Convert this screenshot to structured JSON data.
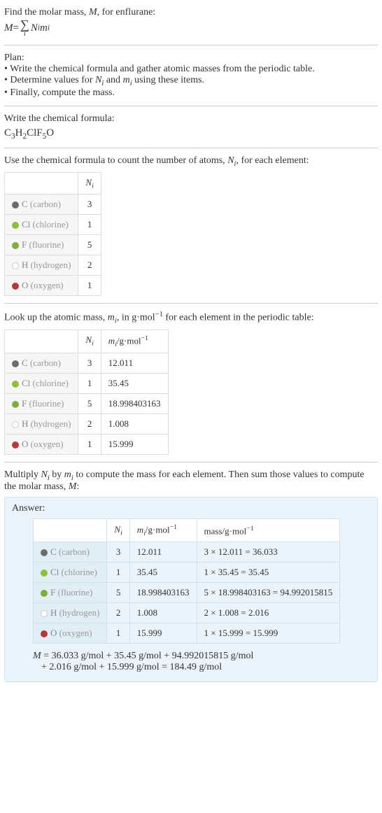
{
  "intro": {
    "line1_a": "Find the molar mass, ",
    "line1_b": "M",
    "line1_c": ", for enflurane:",
    "eq_lhs": "M",
    "eq_eq": " = ",
    "eq_N": "N",
    "eq_i1": "i",
    "eq_m": "m",
    "eq_i2": "i",
    "sigma_sub": "i"
  },
  "plan": {
    "heading": "Plan:",
    "b1_a": "• Write the chemical formula and gather atomic masses from the periodic table.",
    "b2_a": "• Determine values for ",
    "b2_N": "N",
    "b2_i1": "i",
    "b2_mid": " and ",
    "b2_m": "m",
    "b2_i2": "i",
    "b2_end": " using these items.",
    "b3": "• Finally, compute the mass."
  },
  "chem": {
    "heading": "Write the chemical formula:",
    "C": "C",
    "n3": "3",
    "H": "H",
    "n2": "2",
    "Cl": "Cl",
    "F": "F",
    "n5": "5",
    "O": "O"
  },
  "count": {
    "text_a": "Use the chemical formula to count the number of atoms, ",
    "text_N": "N",
    "text_i": "i",
    "text_b": ", for each element:",
    "col_N": "N",
    "col_i": "i"
  },
  "elements": [
    {
      "sw": "#6b6b6b",
      "sym": "C",
      "name": "(carbon)",
      "N": "3",
      "m": "12.011",
      "mass": "3 × 12.011 = 36.033"
    },
    {
      "sw": "#8fbf3f",
      "sym": "Cl",
      "name": "(chlorine)",
      "N": "1",
      "m": "35.45",
      "mass": "1 × 35.45 = 35.45"
    },
    {
      "sw": "#7fae3a",
      "sym": "F",
      "name": "(fluorine)",
      "N": "5",
      "m": "18.998403163",
      "mass": "5 × 18.998403163 = 94.992015815"
    },
    {
      "sw": "#ffffff",
      "sym": "H",
      "name": "(hydrogen)",
      "N": "2",
      "m": "1.008",
      "mass": "2 × 1.008 = 2.016"
    },
    {
      "sw": "#b33a3a",
      "sym": "O",
      "name": "(oxygen)",
      "N": "1",
      "m": "15.999",
      "mass": "1 × 15.999 = 15.999"
    }
  ],
  "lookup": {
    "text_a": "Look up the atomic mass, ",
    "text_m": "m",
    "text_i": "i",
    "text_b": ", in g·mol",
    "text_exp": "−1",
    "text_c": " for each element in the periodic table:",
    "col_N": "N",
    "col_Ni": "i",
    "col_m": "m",
    "col_mi": "i",
    "col_unit": "/g·mol",
    "col_exp": "−1"
  },
  "multiply": {
    "text_a": "Multiply ",
    "N": "N",
    "Ni": "i",
    "text_b": " by ",
    "m": "m",
    "mi": "i",
    "text_c": " to compute the mass for each element. Then sum those values to compute the molar mass, ",
    "M": "M",
    "text_d": ":"
  },
  "answer": {
    "label": "Answer:",
    "col_N": "N",
    "col_Ni": "i",
    "col_m": "m",
    "col_mi": "i",
    "col_munit": "/g·mol",
    "col_mexp": "−1",
    "col_mass": "mass/g·mol",
    "col_massexp": "−1",
    "final_a": "M",
    "final_b": " = 36.033 g/mol + 35.45 g/mol + 94.992015815 g/mol",
    "final_c": "+ 2.016 g/mol + 15.999 g/mol = 184.49 g/mol"
  }
}
